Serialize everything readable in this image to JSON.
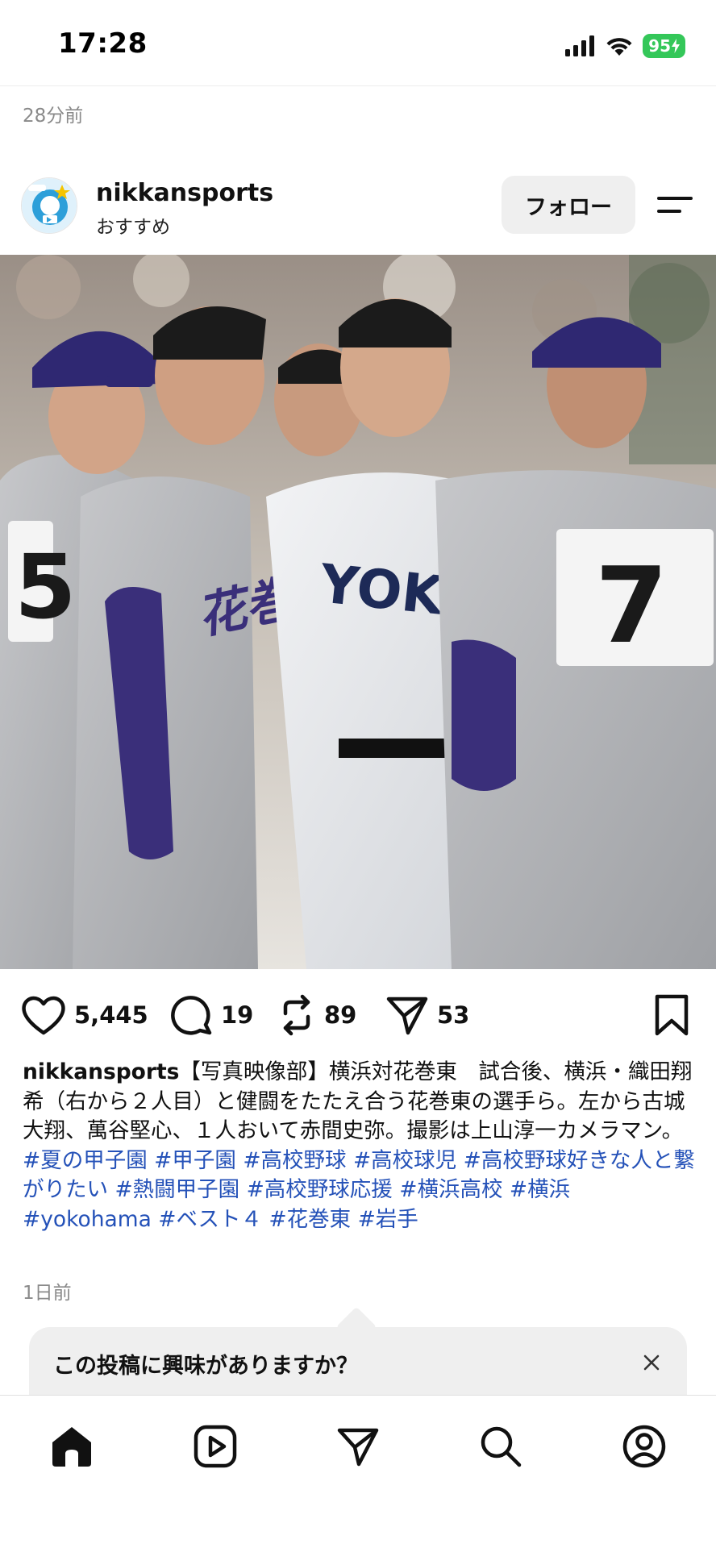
{
  "status_bar": {
    "time": "17:28",
    "battery": "95"
  },
  "feed": {
    "previous_post_timestamp": "28分前"
  },
  "post": {
    "username": "nikkansports",
    "subtitle": "おすすめ",
    "follow_label": "フォロー",
    "photo_description_icon": "photo",
    "likes": "5,445",
    "comments": "19",
    "reposts": "89",
    "shares": "53",
    "caption_user": "nikkansports",
    "caption_text": "【写真映像部】横浜対花巻東　試合後、横浜・織田翔希（右から２人目）と健闘をたたえ合う花巻東の選手ら。左から古城大翔、萬谷堅心、１人おいて赤間史弥。撮影は上山淳一カメラマン。",
    "hashtags": [
      "#夏の甲子園",
      "#甲子園",
      "#高校野球",
      "#高校球児",
      "#高校野球好きな人と繋がりたい",
      "#熱闘甲子園",
      "#高校野球応援",
      "#横浜高校",
      "#横浜",
      "#yokohama",
      "#ベスト４",
      "#花巻東",
      "#岩手"
    ],
    "timestamp": "1日前",
    "photo_texts": {
      "jersey_left": "5",
      "jersey_right": "7",
      "team_front": "YOKOHA"
    }
  },
  "interest_prompt": {
    "text": "この投稿に興味がありますか？"
  },
  "nav": {
    "items": [
      "home-icon",
      "reels-icon",
      "send-icon",
      "search-icon",
      "profile-icon"
    ]
  },
  "colors": {
    "hashtag": "#2451b8",
    "battery": "#34c759",
    "uniform_navy": "#3a2f7a"
  }
}
